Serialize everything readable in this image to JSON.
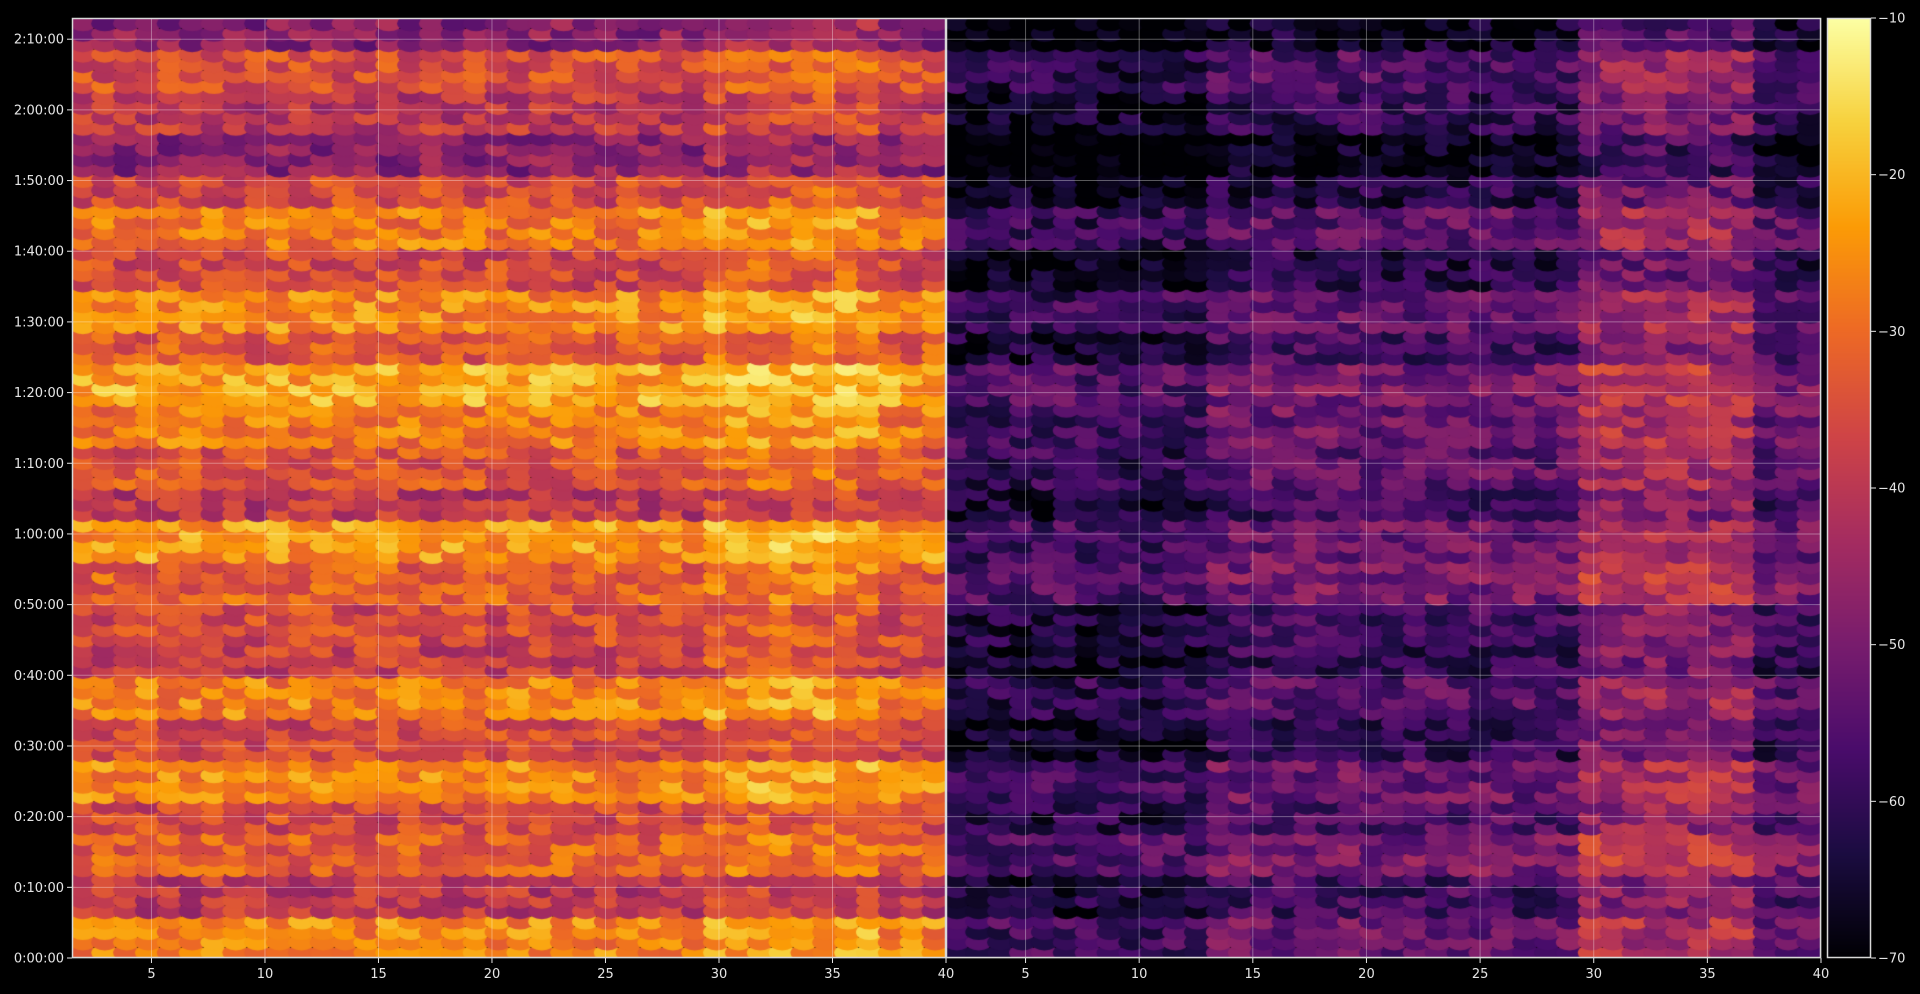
{
  "chart_data": {
    "type": "heatmap",
    "title": "",
    "xlabel": "",
    "ylabel": "",
    "grid": true,
    "background_color": "#000000",
    "colormap": "inferno",
    "colormap_stops": [
      "#000004",
      "#1b0c41",
      "#4a0c6b",
      "#781c6d",
      "#a52c60",
      "#cf4446",
      "#ed6925",
      "#fb9b06",
      "#f7d13d",
      "#fcffa4"
    ],
    "panels": [
      {
        "name": "left",
        "xlim": [
          1.5,
          40
        ],
        "x_ticks": [
          5,
          10,
          15,
          20,
          25,
          30,
          35,
          40
        ],
        "row_band_values": [
          -26,
          -40,
          -32,
          -36,
          -26,
          -36,
          -27,
          -38,
          -36,
          -32,
          -24,
          -40,
          -34,
          -28,
          -22,
          -33,
          -26,
          -36,
          -28,
          -36,
          -48,
          -40,
          -35,
          -48
        ]
      },
      {
        "name": "right",
        "xlim": [
          1.5,
          40
        ],
        "x_ticks": [
          5,
          10,
          15,
          20,
          25,
          30,
          35,
          40
        ],
        "row_band_values": [
          -52,
          -58,
          -50,
          -56,
          -52,
          -60,
          -55,
          -60,
          -58,
          -50,
          -52,
          -58,
          -54,
          -52,
          -50,
          -58,
          -53,
          -62,
          -54,
          -62,
          -68,
          -60,
          -56,
          -66
        ]
      }
    ],
    "y_ticks": [
      "0:00:00",
      "0:10:00",
      "0:20:00",
      "0:30:00",
      "0:40:00",
      "0:50:00",
      "1:00:00",
      "1:10:00",
      "1:20:00",
      "1:30:00",
      "1:40:00",
      "1:50:00",
      "2:00:00",
      "2:10:00"
    ],
    "ylim_seconds": [
      0,
      7980
    ],
    "colorbar": {
      "min": -70,
      "max": -10,
      "ticks": [
        "-10",
        "-20",
        "-30",
        "-40",
        "-50",
        "-60",
        "-70"
      ]
    }
  }
}
